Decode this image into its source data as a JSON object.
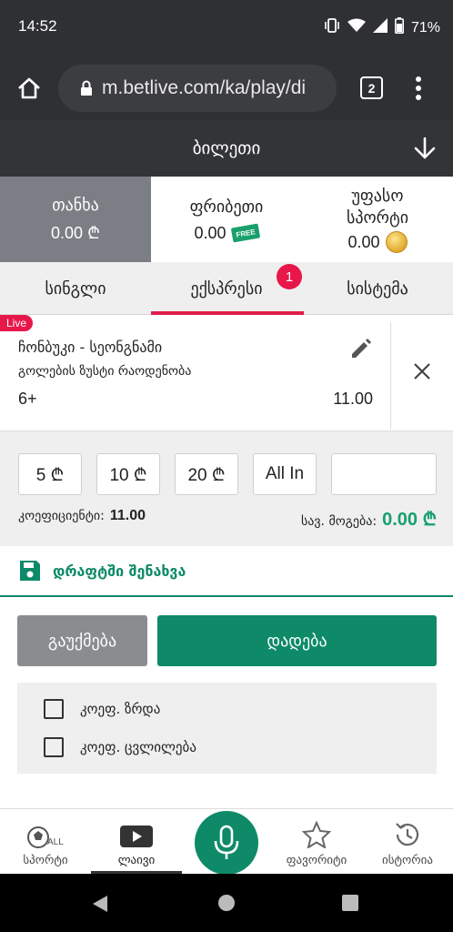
{
  "status_bar": {
    "time": "14:52",
    "battery": "71%"
  },
  "browser": {
    "url": "m.betlive.com/ka/play/di",
    "tab_count": "2"
  },
  "header": {
    "title": "ბილეთი"
  },
  "balances": [
    {
      "label": "თანხა",
      "value": "0.00 ₾"
    },
    {
      "label": "ფრიბეთი",
      "value": "0.00",
      "badge": "FREE"
    },
    {
      "label": "უფასო სპორტი",
      "value": "0.00"
    }
  ],
  "tabs": [
    {
      "label": "სინგლი"
    },
    {
      "label": "ექსპრესი",
      "badge": "1"
    },
    {
      "label": "სისტემა"
    }
  ],
  "bet": {
    "live": "Live",
    "match": "ჩონბუკი - სეონგნამი",
    "market": "გოლების ზუსტი რაოდენობა",
    "selection": "6+",
    "odds": "11.00"
  },
  "stakes": {
    "buttons": [
      "5 ₾",
      "10 ₾",
      "20 ₾",
      "All In"
    ],
    "coef_label": "კოეფიციენტი:",
    "coef_value": "11.00",
    "win_label": "სავ. მოგება:",
    "win_value": "0.00 ₾"
  },
  "draft": {
    "label": "დრაფტში შენახვა"
  },
  "actions": {
    "cancel": "გაუქმება",
    "place": "დადება"
  },
  "options": [
    {
      "label": "კოეფ. ზრდა"
    },
    {
      "label": "კოეფ. ცვლილება"
    }
  ],
  "bottom_nav": [
    {
      "label": "სპორტი"
    },
    {
      "label": "ლაივი"
    },
    {
      "label": ""
    },
    {
      "label": "ფავორიტი"
    },
    {
      "label": "ისტორია"
    }
  ],
  "colors": {
    "accent": "#0e8a68",
    "live": "#e8174a",
    "tab_underline": "#e21d4b"
  }
}
